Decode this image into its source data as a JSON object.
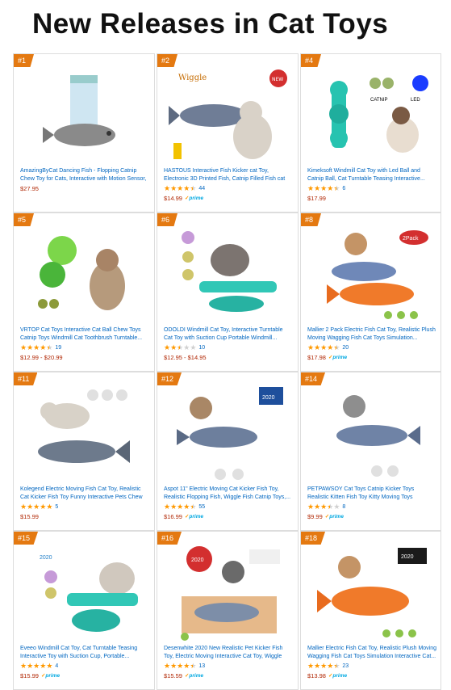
{
  "page": {
    "title": "New Releases in Cat Toys"
  },
  "colors": {
    "rank_badge": "#e47911",
    "link": "#0066c0",
    "price": "#b12704",
    "star": "#ff9900",
    "prime": "#00a8e1"
  },
  "products": [
    {
      "rank": "#1",
      "image": "cat-toy-fish-box-image",
      "title": "AmazingByCat Dancing Fish - Flopping Catnip Chew Toy for Cats, Interactive with Motion Sensor, USB Charged, Catnip Pouches Included (Original Model)",
      "rating": 0,
      "count": "",
      "price": "$27.95",
      "prime": false
    },
    {
      "rank": "#2",
      "image": "wiggle-fish-cat-image",
      "title": "HASTOUS Interactive Fish Kicker cat Toy, Electronic 3D Printed Fish, Catnip Filled Fish cat Toy,...",
      "rating": 4.5,
      "count": "44",
      "price": "$14.99",
      "prime": true
    },
    {
      "rank": "#4",
      "image": "windmill-catnip-led-image",
      "title": "Kimeksoft Windmill Cat Toy with Led Ball and Catnip Ball, Cat Turntable Teasing Interactive...",
      "rating": 4.5,
      "count": "6",
      "price": "$17.99",
      "prime": false
    },
    {
      "rank": "#5",
      "image": "green-ball-chew-toy-image",
      "title": "VRTOP Cat Toys Interactive Cat Ball Chew Toys Catnip Toys Windmill Cat Toothbrush Turntable...",
      "rating": 4.5,
      "count": "19",
      "price": "$12.99 - $20.99",
      "prime": false
    },
    {
      "rank": "#6",
      "image": "windmill-suction-cup-image",
      "title": "ODOLDI Windmill Cat Toy, Interactive Turntable Cat Toy with Suction Cup Portable Windmill...",
      "rating": 2.5,
      "count": "10",
      "price": "$12.95 - $14.95",
      "prime": false
    },
    {
      "rank": "#8",
      "image": "two-pack-fish-image",
      "title": "Mallier 2 Pack Electric Fish Cat Toy, Realistic Plush Moving Wagging Fish Cat Toys Simulation...",
      "rating": 4.5,
      "count": "20",
      "price": "$17.98",
      "prime": true
    },
    {
      "rank": "#11",
      "image": "moving-fish-cat-image",
      "title": "Kolegend Electric Moving Fish Cat Toy, Realistic Cat Kicker Fish Toy Funny Interactive Pets Chew Bite...",
      "rating": 5,
      "count": "5",
      "price": "$15.99",
      "prime": false
    },
    {
      "rank": "#12",
      "image": "newest-fish-kicker-image",
      "title": "Aspot 11\" Electric Moving Cat Kicker Fish Toy, Realistic Flopping Fish, Wiggle Fish Catnip Toys,...",
      "rating": 4.5,
      "count": "55",
      "price": "$16.99",
      "prime": true
    },
    {
      "rank": "#14",
      "image": "kitten-fish-kicker-image",
      "title": "PETPAWSOY Cat Toys Catnip Kicker Toys Realistic Kitten Fish Toy Kitty Moving Toys",
      "rating": 3.5,
      "count": "8",
      "price": "$9.99",
      "prime": true
    },
    {
      "rank": "#15",
      "image": "windmill-turntable-image",
      "title": "Eveeo Windmill Cat Toy, Cat Turntable Teasing Interactive Toy with Suction Cup, Portable...",
      "rating": 5,
      "count": "4",
      "price": "$15.99",
      "prime": true
    },
    {
      "rank": "#16",
      "image": "realistic-pet-kicker-image",
      "title": "Desenwhite 2020 New Realistic Pet Kicker Fish Toy, Electric Moving Interactive Cat Toy, Wiggle Fish...",
      "rating": 4.5,
      "count": "13",
      "price": "$15.59",
      "prime": true
    },
    {
      "rank": "#18",
      "image": "orange-wagging-fish-image",
      "title": "Mallier Electric Fish Cat Toy, Realistic Plush Moving Wagging Fish Cat Toys Simulation Interactive Cat...",
      "rating": 4.5,
      "count": "23",
      "price": "$13.98",
      "prime": true
    }
  ],
  "prime_label": "prime"
}
